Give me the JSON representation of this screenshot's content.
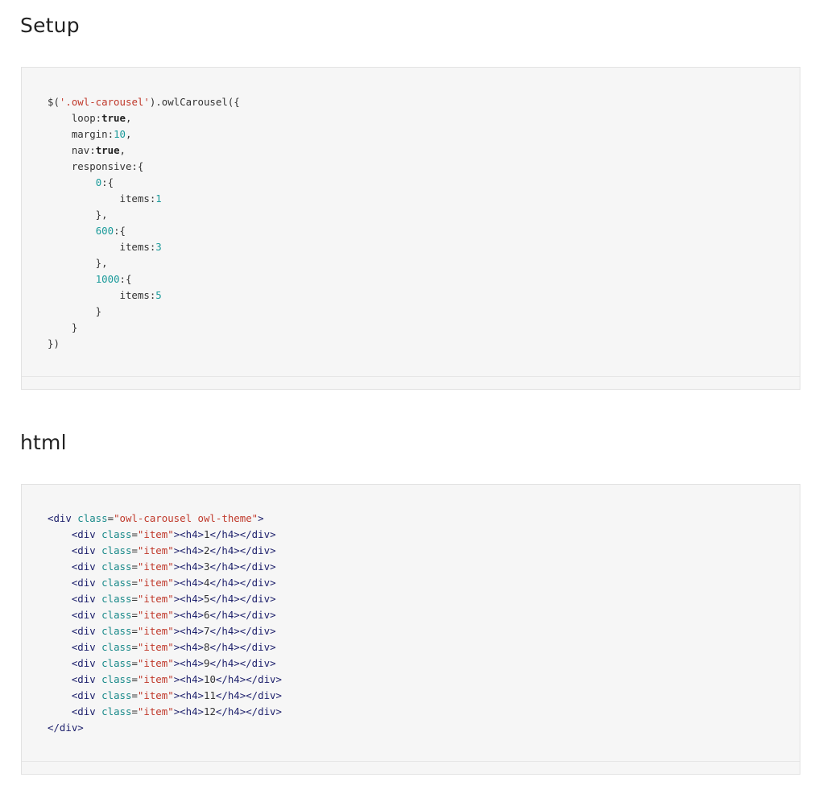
{
  "sections": [
    {
      "heading": "Setup",
      "code_lines": [
        [
          {
            "t": "$(",
            "k": "plain"
          },
          {
            "t": "'.owl-carousel'",
            "k": "string"
          },
          {
            "t": ").owlCarousel({",
            "k": "plain"
          }
        ],
        [
          {
            "t": "    loop:",
            "k": "plain"
          },
          {
            "t": "true",
            "k": "bold"
          },
          {
            "t": ",",
            "k": "plain"
          }
        ],
        [
          {
            "t": "    margin:",
            "k": "plain"
          },
          {
            "t": "10",
            "k": "number"
          },
          {
            "t": ",",
            "k": "plain"
          }
        ],
        [
          {
            "t": "    nav:",
            "k": "plain"
          },
          {
            "t": "true",
            "k": "bold"
          },
          {
            "t": ",",
            "k": "plain"
          }
        ],
        [
          {
            "t": "    responsive:{",
            "k": "plain"
          }
        ],
        [
          {
            "t": "        ",
            "k": "plain"
          },
          {
            "t": "0",
            "k": "number"
          },
          {
            "t": ":{",
            "k": "plain"
          }
        ],
        [
          {
            "t": "            items:",
            "k": "plain"
          },
          {
            "t": "1",
            "k": "number"
          }
        ],
        [
          {
            "t": "        },",
            "k": "plain"
          }
        ],
        [
          {
            "t": "        ",
            "k": "plain"
          },
          {
            "t": "600",
            "k": "number"
          },
          {
            "t": ":{",
            "k": "plain"
          }
        ],
        [
          {
            "t": "            items:",
            "k": "plain"
          },
          {
            "t": "3",
            "k": "number"
          }
        ],
        [
          {
            "t": "        },",
            "k": "plain"
          }
        ],
        [
          {
            "t": "        ",
            "k": "plain"
          },
          {
            "t": "1000",
            "k": "number"
          },
          {
            "t": ":{",
            "k": "plain"
          }
        ],
        [
          {
            "t": "            items:",
            "k": "plain"
          },
          {
            "t": "5",
            "k": "number"
          }
        ],
        [
          {
            "t": "        }",
            "k": "plain"
          }
        ],
        [
          {
            "t": "    }",
            "k": "plain"
          }
        ],
        [
          {
            "t": "})",
            "k": "plain"
          }
        ]
      ]
    },
    {
      "heading": "html",
      "code_lines": [
        [
          {
            "t": "<div",
            "k": "tag"
          },
          {
            "t": " class",
            "k": "attr"
          },
          {
            "t": "=",
            "k": "plain"
          },
          {
            "t": "\"owl-carousel owl-theme\"",
            "k": "string"
          },
          {
            "t": ">",
            "k": "tag"
          }
        ],
        [
          {
            "t": "    ",
            "k": "plain"
          },
          {
            "t": "<div",
            "k": "tag"
          },
          {
            "t": " class",
            "k": "attr"
          },
          {
            "t": "=",
            "k": "plain"
          },
          {
            "t": "\"item\"",
            "k": "string"
          },
          {
            "t": "><h4>",
            "k": "tag"
          },
          {
            "t": "1",
            "k": "plain"
          },
          {
            "t": "</h4></div>",
            "k": "tag"
          }
        ],
        [
          {
            "t": "    ",
            "k": "plain"
          },
          {
            "t": "<div",
            "k": "tag"
          },
          {
            "t": " class",
            "k": "attr"
          },
          {
            "t": "=",
            "k": "plain"
          },
          {
            "t": "\"item\"",
            "k": "string"
          },
          {
            "t": "><h4>",
            "k": "tag"
          },
          {
            "t": "2",
            "k": "plain"
          },
          {
            "t": "</h4></div>",
            "k": "tag"
          }
        ],
        [
          {
            "t": "    ",
            "k": "plain"
          },
          {
            "t": "<div",
            "k": "tag"
          },
          {
            "t": " class",
            "k": "attr"
          },
          {
            "t": "=",
            "k": "plain"
          },
          {
            "t": "\"item\"",
            "k": "string"
          },
          {
            "t": "><h4>",
            "k": "tag"
          },
          {
            "t": "3",
            "k": "plain"
          },
          {
            "t": "</h4></div>",
            "k": "tag"
          }
        ],
        [
          {
            "t": "    ",
            "k": "plain"
          },
          {
            "t": "<div",
            "k": "tag"
          },
          {
            "t": " class",
            "k": "attr"
          },
          {
            "t": "=",
            "k": "plain"
          },
          {
            "t": "\"item\"",
            "k": "string"
          },
          {
            "t": "><h4>",
            "k": "tag"
          },
          {
            "t": "4",
            "k": "plain"
          },
          {
            "t": "</h4></div>",
            "k": "tag"
          }
        ],
        [
          {
            "t": "    ",
            "k": "plain"
          },
          {
            "t": "<div",
            "k": "tag"
          },
          {
            "t": " class",
            "k": "attr"
          },
          {
            "t": "=",
            "k": "plain"
          },
          {
            "t": "\"item\"",
            "k": "string"
          },
          {
            "t": "><h4>",
            "k": "tag"
          },
          {
            "t": "5",
            "k": "plain"
          },
          {
            "t": "</h4></div>",
            "k": "tag"
          }
        ],
        [
          {
            "t": "    ",
            "k": "plain"
          },
          {
            "t": "<div",
            "k": "tag"
          },
          {
            "t": " class",
            "k": "attr"
          },
          {
            "t": "=",
            "k": "plain"
          },
          {
            "t": "\"item\"",
            "k": "string"
          },
          {
            "t": "><h4>",
            "k": "tag"
          },
          {
            "t": "6",
            "k": "plain"
          },
          {
            "t": "</h4></div>",
            "k": "tag"
          }
        ],
        [
          {
            "t": "    ",
            "k": "plain"
          },
          {
            "t": "<div",
            "k": "tag"
          },
          {
            "t": " class",
            "k": "attr"
          },
          {
            "t": "=",
            "k": "plain"
          },
          {
            "t": "\"item\"",
            "k": "string"
          },
          {
            "t": "><h4>",
            "k": "tag"
          },
          {
            "t": "7",
            "k": "plain"
          },
          {
            "t": "</h4></div>",
            "k": "tag"
          }
        ],
        [
          {
            "t": "    ",
            "k": "plain"
          },
          {
            "t": "<div",
            "k": "tag"
          },
          {
            "t": " class",
            "k": "attr"
          },
          {
            "t": "=",
            "k": "plain"
          },
          {
            "t": "\"item\"",
            "k": "string"
          },
          {
            "t": "><h4>",
            "k": "tag"
          },
          {
            "t": "8",
            "k": "plain"
          },
          {
            "t": "</h4></div>",
            "k": "tag"
          }
        ],
        [
          {
            "t": "    ",
            "k": "plain"
          },
          {
            "t": "<div",
            "k": "tag"
          },
          {
            "t": " class",
            "k": "attr"
          },
          {
            "t": "=",
            "k": "plain"
          },
          {
            "t": "\"item\"",
            "k": "string"
          },
          {
            "t": "><h4>",
            "k": "tag"
          },
          {
            "t": "9",
            "k": "plain"
          },
          {
            "t": "</h4></div>",
            "k": "tag"
          }
        ],
        [
          {
            "t": "    ",
            "k": "plain"
          },
          {
            "t": "<div",
            "k": "tag"
          },
          {
            "t": " class",
            "k": "attr"
          },
          {
            "t": "=",
            "k": "plain"
          },
          {
            "t": "\"item\"",
            "k": "string"
          },
          {
            "t": "><h4>",
            "k": "tag"
          },
          {
            "t": "10",
            "k": "plain"
          },
          {
            "t": "</h4></div>",
            "k": "tag"
          }
        ],
        [
          {
            "t": "    ",
            "k": "plain"
          },
          {
            "t": "<div",
            "k": "tag"
          },
          {
            "t": " class",
            "k": "attr"
          },
          {
            "t": "=",
            "k": "plain"
          },
          {
            "t": "\"item\"",
            "k": "string"
          },
          {
            "t": "><h4>",
            "k": "tag"
          },
          {
            "t": "11",
            "k": "plain"
          },
          {
            "t": "</h4></div>",
            "k": "tag"
          }
        ],
        [
          {
            "t": "    ",
            "k": "plain"
          },
          {
            "t": "<div",
            "k": "tag"
          },
          {
            "t": " class",
            "k": "attr"
          },
          {
            "t": "=",
            "k": "plain"
          },
          {
            "t": "\"item\"",
            "k": "string"
          },
          {
            "t": "><h4>",
            "k": "tag"
          },
          {
            "t": "12",
            "k": "plain"
          },
          {
            "t": "</h4></div>",
            "k": "tag"
          }
        ],
        [
          {
            "t": "</div>",
            "k": "tag"
          }
        ]
      ]
    }
  ],
  "colors": {
    "code_background": "#f6f6f6",
    "code_border": "#e2e2e2",
    "string": "#c0392b",
    "number": "#1a9a9a",
    "tag": "#1c1f6b",
    "attribute": "#1a8a8a"
  }
}
